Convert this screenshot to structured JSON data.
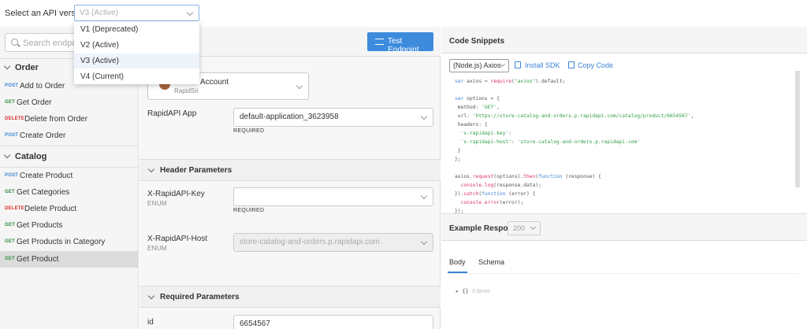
{
  "topbar": {
    "label": "Select an API version:",
    "selected_version": "V3 (Active)"
  },
  "version_options": [
    "V1 (Deprecated)",
    "V2 (Active)",
    "V3 (Active)",
    "V4 (Current)"
  ],
  "sidebar": {
    "search_placeholder": "Search endpoints",
    "groups": [
      {
        "name": "Order",
        "endpoints": [
          {
            "method": "POST",
            "name": "Add to Order"
          },
          {
            "method": "GET",
            "name": "Get Order"
          },
          {
            "method": "DELETE",
            "name": "Delete from Order"
          },
          {
            "method": "POST",
            "name": "Create Order"
          }
        ]
      },
      {
        "name": "Catalog",
        "endpoints": [
          {
            "method": "POST",
            "name": "Create Product"
          },
          {
            "method": "GET",
            "name": "Get Categories"
          },
          {
            "method": "DELETE",
            "name": "Delete Product"
          },
          {
            "method": "GET",
            "name": "Get Products"
          },
          {
            "method": "GET",
            "name": "Get Products in Category"
          },
          {
            "method": "GET",
            "name": "Get Product"
          }
        ]
      }
    ]
  },
  "middle": {
    "test_button": "Test Endpoint",
    "account": {
      "name": "Account",
      "sub": "RapidSri"
    },
    "app": {
      "label": "RapidAPI App",
      "value": "default-application_3623958",
      "required": "REQUIRED"
    },
    "header_section": "Header Parameters",
    "key_field": {
      "label": "X-RapidAPI-Key",
      "type": "ENUM",
      "value": "",
      "required": "REQUIRED"
    },
    "host_field": {
      "label": "X-RapidAPI-Host",
      "type": "ENUM",
      "value": "store-catalog-and-orders.p.rapidapi.com"
    },
    "required_section": "Required Parameters",
    "id_field": {
      "label": "id",
      "value": "6654567"
    }
  },
  "right": {
    "title": "Code Snippets",
    "language": "(Node.js) Axios",
    "install_sdk": "Install SDK",
    "copy_code": "Copy Code",
    "code": {
      "l1_kw": "var",
      "l1_a": " axios = ",
      "l1_fn": "require",
      "l1_b": "(",
      "l1_st": "\"axios\"",
      "l1_c": ").default;",
      "l2_kw": "var",
      "l2_a": " options = {",
      "l3_a": " method: ",
      "l3_st": "'GET'",
      "l3_b": ",",
      "l4_a": " url: ",
      "l4_st": "'https://store-catalog-and-orders.p.rapidapi.com/catalog/product/6654567'",
      "l4_b": ",",
      "l5_a": " headers: {",
      "l6_st": "  'x-rapidapi-key'",
      "l6_b": ":",
      "l7_st": "  'x-rapidapi-host'",
      "l7_b": ": ",
      "l7_st2": "'store-catalog-and-orders.p.rapidapi.com'",
      "l8_a": " }",
      "l9_a": "};",
      "l10_a": "axios.",
      "l10_fn": "request",
      "l10_b": "(options).",
      "l10_fn2": "then",
      "l10_c": "(",
      "l10_kw": "function",
      "l10_d": " (response) {",
      "l11_fn": "  console.log",
      "l11_a": "(response.data);",
      "l12_a": "}).",
      "l12_fn": "catch",
      "l12_b": "(",
      "l12_kw": "function",
      "l12_c": " (error) {",
      "l13_fn": "  console.error",
      "l13_a": "(error);",
      "l14_a": "});"
    },
    "example_response": "Example Response",
    "status_code": "200",
    "tabs": [
      "Body",
      "Schema"
    ],
    "tree_braces": "{}",
    "tree_items": "0 items"
  }
}
